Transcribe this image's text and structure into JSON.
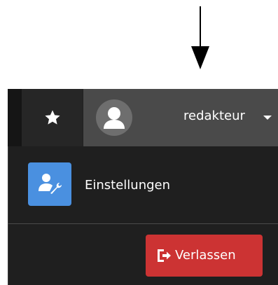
{
  "annotation": {
    "arrow_icon": "down-arrow"
  },
  "topbar": {
    "favorites_icon": "star-icon",
    "avatar_icon": "user-avatar-icon",
    "username": "redakteur",
    "caret_icon": "caret-down-icon"
  },
  "dropdown": {
    "settings": {
      "icon": "user-settings-icon",
      "label": "Einstellungen"
    },
    "logout": {
      "icon": "sign-out-icon",
      "label": "Verlassen"
    }
  },
  "colors": {
    "topbar_bg": "#202020",
    "favorites_bg": "#262626",
    "user_menu_bg": "#4a4a4a",
    "dropdown_bg": "#1f1f1f",
    "settings_icon_bg": "#4a90e0",
    "logout_bg": "#cc3333"
  }
}
